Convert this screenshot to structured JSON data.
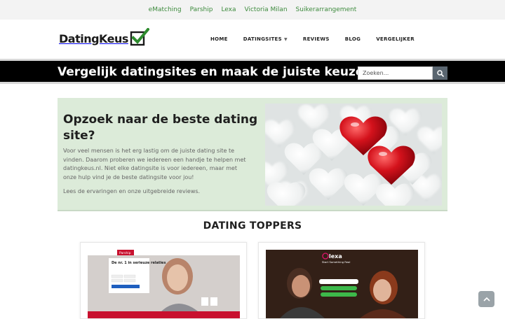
{
  "topbar": {
    "links": [
      "eMatching",
      "Parship",
      "Lexa",
      "Victoria Milan",
      "Suikerarrangement"
    ]
  },
  "header": {
    "logo_text": "DatingKeus",
    "nav": {
      "home": "HOME",
      "datingsites": "DATINGSITES",
      "reviews": "REVIEWS",
      "blog": "BLOG",
      "vergelijker": "VERGELIJKER"
    }
  },
  "banner": {
    "title": "Vergelijk datingsites en maak de juiste keuze!",
    "search_placeholder": "Zoeken..."
  },
  "hero": {
    "title": "Opzoek naar de beste dating site?",
    "text": "Voor veel mensen is het erg lastig om de juiste dating site te vinden. Daarom proberen we iedereen een handje te helpen met datingkeus.nl. Niet elke datingsite is voor iedereen, maar met onze hulp vind je de beste datingsite voor jou!",
    "text2": "Lees de ervaringen en onze uitgebreide reviews."
  },
  "section": {
    "title": "DATING TOPPERS"
  },
  "cards": {
    "parship": {
      "brand": "Parship",
      "headline": "De nr. 1 in serieuze relaties"
    },
    "lexa": {
      "brand": "lexa",
      "tagline": "Start Something Real"
    }
  },
  "colors": {
    "accent_green": "#3c8a3c",
    "banner_bg": "#000000",
    "hero_bg": "#dcebd9",
    "parship_red": "#c8102e",
    "lexa_pink": "#e0146b"
  }
}
